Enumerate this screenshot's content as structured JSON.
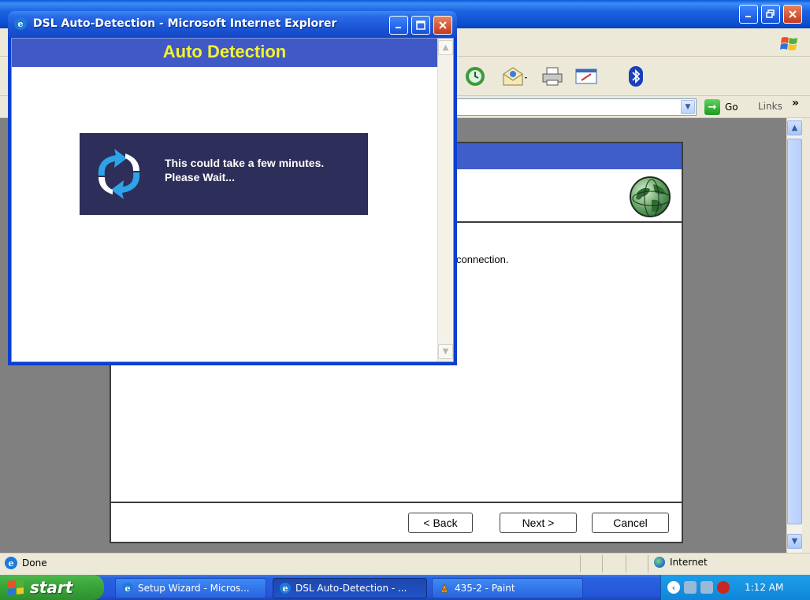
{
  "popup": {
    "title": "DSL Auto-Detection - Microsoft Internet Explorer",
    "header": "Auto Detection",
    "wait_line1": "This could take a few minutes.",
    "wait_line2": "Please Wait...",
    "icons": [
      "ie-icon",
      "refresh-arrows-icon",
      "minimize-icon",
      "maximize-icon",
      "close-icon"
    ]
  },
  "browser": {
    "go_label": "Go",
    "links_label": "Links",
    "links_chevron": "»",
    "toolbar_icons": [
      "history-icon",
      "mail-icon",
      "print-icon",
      "edit-icon",
      "bluetooth-icon"
    ]
  },
  "wizard": {
    "body_text": "connection.",
    "back_label": "< Back",
    "next_label": "Next >",
    "cancel_label": "Cancel"
  },
  "statusbar": {
    "status": "Done",
    "zone": "Internet"
  },
  "taskbar": {
    "start_label": "start",
    "items": [
      {
        "label": "Setup Wizard - Micros...",
        "icon": "ie-icon"
      },
      {
        "label": "DSL Auto-Detection - ...",
        "icon": "ie-icon"
      },
      {
        "label": "435-2 - Paint",
        "icon": "paint-icon"
      }
    ],
    "clock": "1:12 AM"
  },
  "colors": {
    "xp_blue": "#0a4fd0",
    "header_blue": "#4159c6",
    "header_text_yellow": "#f5f32a",
    "wait_box_bg": "#2e2e5a",
    "start_green": "#3aa83a"
  }
}
